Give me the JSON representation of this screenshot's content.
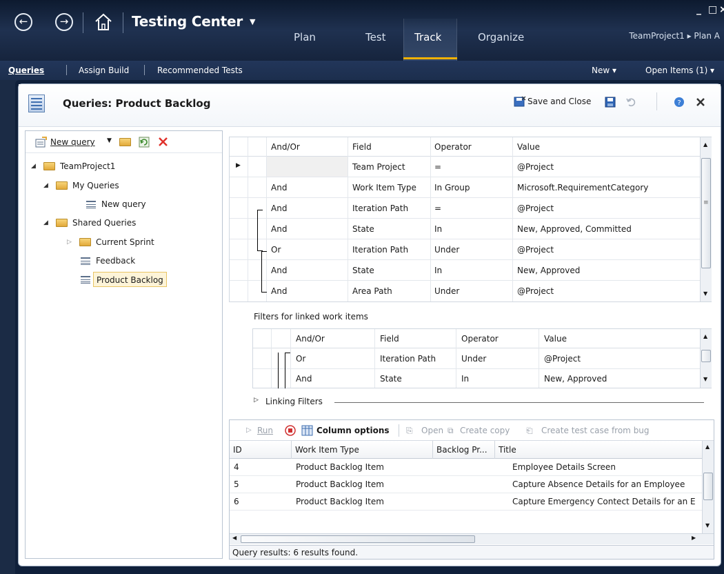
{
  "topbar": {
    "app_title": "Testing Center",
    "tabs": [
      "Plan",
      "Test",
      "Track",
      "Organize"
    ],
    "active_tab": "Track",
    "project_path": "TeamProject1 ▸ Plan A",
    "window_controls": {
      "minimize": "_",
      "maximize": "□",
      "close": "×"
    }
  },
  "subnav": {
    "items": [
      "Queries",
      "Assign Build",
      "Recommended Tests"
    ],
    "new_label": "New ▾",
    "open_items_label": "Open Items (1) ▾"
  },
  "editor": {
    "title": "Queries: Product Backlog",
    "save_close_label": "Save and Close"
  },
  "query_tree": {
    "new_query_label": "New query",
    "nodes": [
      {
        "label": "TeamProject1"
      },
      {
        "label": "My Queries"
      },
      {
        "label": "New query"
      },
      {
        "label": "Shared Queries"
      },
      {
        "label": "Current Sprint"
      },
      {
        "label": "Feedback"
      },
      {
        "label": "Product Backlog"
      }
    ]
  },
  "query_clauses": {
    "headers": [
      "And/Or",
      "Field",
      "Operator",
      "Value"
    ],
    "rows": [
      {
        "andor": "",
        "field": "Team Project",
        "operator": "=",
        "value": "@Project"
      },
      {
        "andor": "And",
        "field": "Work Item Type",
        "operator": "In Group",
        "value": "Microsoft.RequirementCategory"
      },
      {
        "andor": "And",
        "field": "Iteration Path",
        "operator": "=",
        "value": "@Project"
      },
      {
        "andor": "And",
        "field": "State",
        "operator": "In",
        "value": "New, Approved, Committed"
      },
      {
        "andor": "Or",
        "field": "Iteration Path",
        "operator": "Under",
        "value": "@Project"
      },
      {
        "andor": "And",
        "field": "State",
        "operator": "In",
        "value": "New, Approved"
      },
      {
        "andor": "And",
        "field": "Area Path",
        "operator": "Under",
        "value": "@Project"
      }
    ]
  },
  "linked_filters": {
    "label": "Filters for linked work items",
    "headers": [
      "And/Or",
      "Field",
      "Operator",
      "Value"
    ],
    "rows": [
      {
        "andor": "Or",
        "field": "Iteration Path",
        "operator": "Under",
        "value": "@Project"
      },
      {
        "andor": "And",
        "field": "State",
        "operator": "In",
        "value": "New, Approved"
      }
    ],
    "section_label": "Linking Filters"
  },
  "results": {
    "toolbar": {
      "run": "Run",
      "column_options": "Column options",
      "open": "Open",
      "create_copy": "Create copy",
      "create_test_case": "Create test case from bug"
    },
    "headers": [
      "ID",
      "Work Item Type",
      "Backlog Pr...",
      "Title"
    ],
    "rows": [
      {
        "id": "4",
        "type": "Product Backlog Item",
        "backlog": "",
        "title": "Employee Details Screen"
      },
      {
        "id": "5",
        "type": "Product Backlog Item",
        "backlog": "",
        "title": "Capture Absence Details for an Employee"
      },
      {
        "id": "6",
        "type": "Product Backlog Item",
        "backlog": "",
        "title": "Capture Emergency Contect Details for an E"
      }
    ],
    "status": "Query results: 6 results found."
  }
}
